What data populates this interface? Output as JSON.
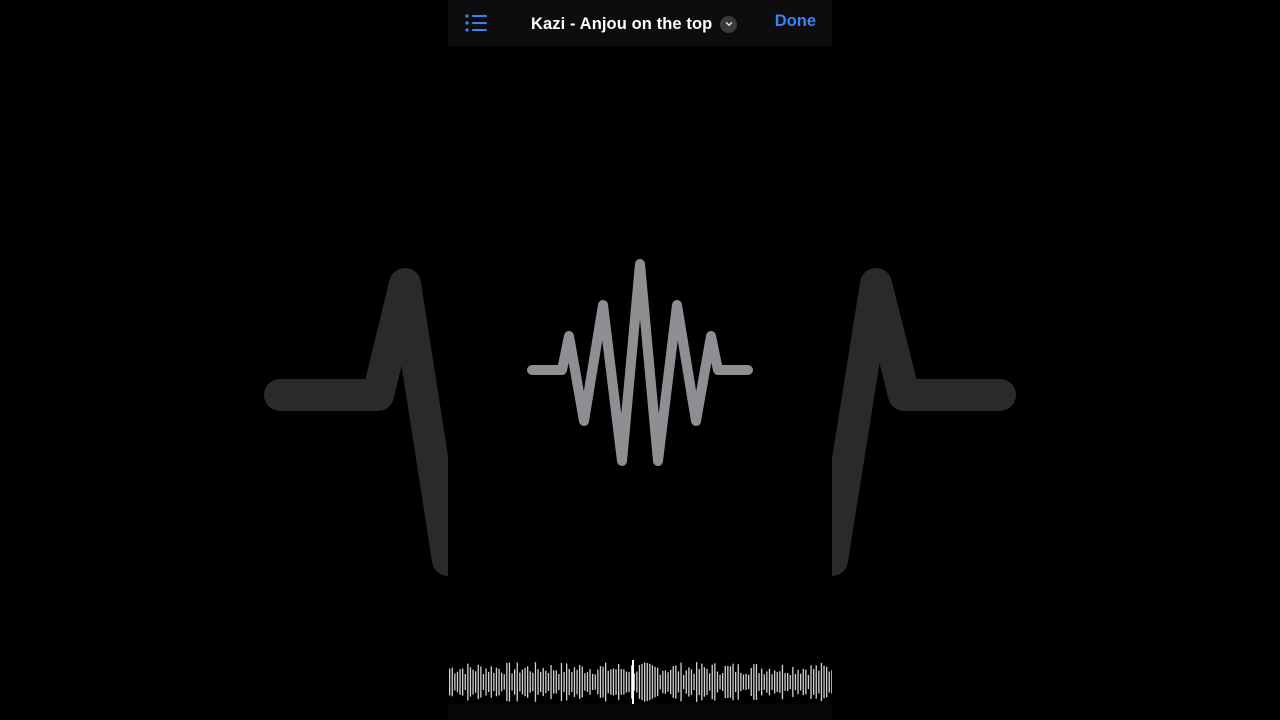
{
  "header": {
    "title": "Kazi - Anjou on the top",
    "done_label": "Done"
  },
  "icons": {
    "list": "list-icon",
    "chevron": "chevron-down-icon",
    "waveform": "waveform-icon"
  },
  "scrubber": {
    "playhead_fraction": 0.5
  },
  "colors": {
    "accent": "#3b82f6",
    "background": "#000000",
    "waveform_icon": "#8e8e93",
    "scrubber_bars": "#d1d1d6",
    "playhead": "#ffffff"
  }
}
